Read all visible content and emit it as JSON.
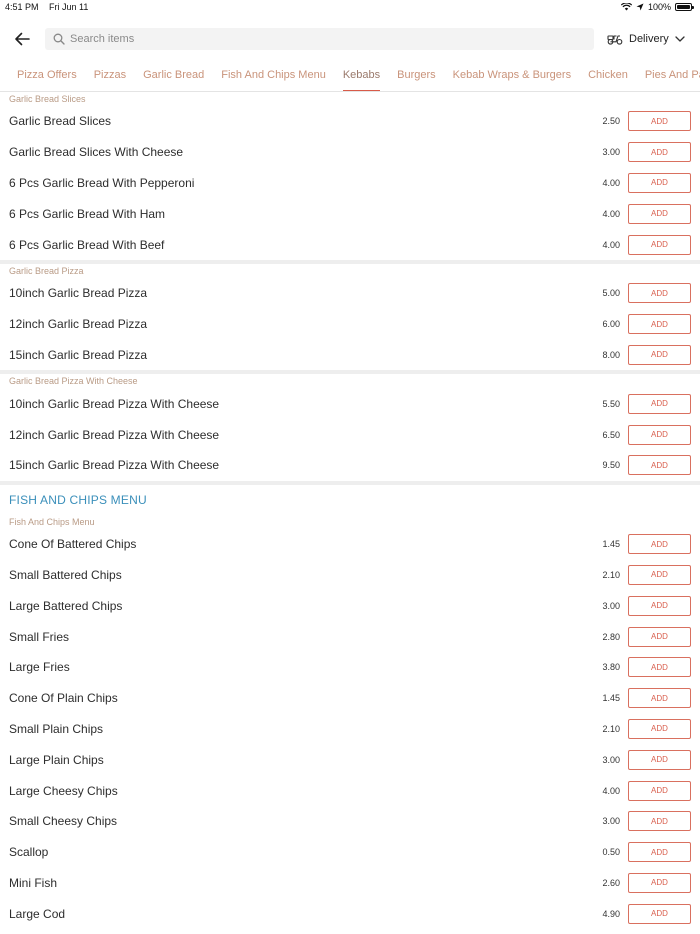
{
  "status": {
    "time": "4:51 PM",
    "date": "Fri Jun 11",
    "battery": "100%"
  },
  "search": {
    "placeholder": "Search items"
  },
  "delivery": {
    "label": "Delivery"
  },
  "tabs": [
    "Pizza Offers",
    "Pizzas",
    "Garlic Bread",
    "Fish And Chips Menu",
    "Kebabs",
    "Burgers",
    "Kebab Wraps & Burgers",
    "Chicken",
    "Pies And Pasties"
  ],
  "active_tab": "Kebabs",
  "add_label": "ADD",
  "sections": [
    {
      "heading": "Garlic Bread Slices",
      "items": [
        {
          "name": "Garlic Bread Slices",
          "price": "2.50"
        },
        {
          "name": "Garlic Bread Slices With Cheese",
          "price": "3.00"
        },
        {
          "name": "6 Pcs Garlic Bread With Pepperoni",
          "price": "4.00"
        },
        {
          "name": "6 Pcs Garlic Bread With Ham",
          "price": "4.00"
        },
        {
          "name": "6 Pcs Garlic Bread With Beef",
          "price": "4.00"
        }
      ]
    },
    {
      "heading": "Garlic Bread Pizza",
      "items": [
        {
          "name": "10inch Garlic Bread Pizza",
          "price": "5.00"
        },
        {
          "name": "12inch Garlic Bread Pizza",
          "price": "6.00"
        },
        {
          "name": "15inch Garlic Bread Pizza",
          "price": "8.00"
        }
      ]
    },
    {
      "heading": "Garlic Bread Pizza With Cheese",
      "items": [
        {
          "name": "10inch Garlic Bread Pizza With Cheese",
          "price": "5.50"
        },
        {
          "name": "12inch Garlic Bread Pizza With Cheese",
          "price": "6.50"
        },
        {
          "name": "15inch Garlic Bread Pizza With Cheese",
          "price": "9.50"
        }
      ]
    },
    {
      "category": "FISH AND CHIPS MENU",
      "heading": "Fish And Chips Menu",
      "items": [
        {
          "name": "Cone Of Battered Chips",
          "price": "1.45"
        },
        {
          "name": "Small Battered Chips",
          "price": "2.10"
        },
        {
          "name": "Large Battered Chips",
          "price": "3.00"
        },
        {
          "name": "Small Fries",
          "price": "2.80"
        },
        {
          "name": "Large Fries",
          "price": "3.80"
        },
        {
          "name": "Cone Of Plain Chips",
          "price": "1.45"
        },
        {
          "name": "Small Plain Chips",
          "price": "2.10"
        },
        {
          "name": "Large Plain Chips",
          "price": "3.00"
        },
        {
          "name": "Large Cheesy Chips",
          "price": "4.00"
        },
        {
          "name": "Small Cheesy Chips",
          "price": "3.00"
        },
        {
          "name": "Scallop",
          "price": "0.50"
        },
        {
          "name": "Mini Fish",
          "price": "2.60"
        },
        {
          "name": "Large Cod",
          "price": "4.90"
        }
      ]
    }
  ],
  "colors": {
    "accent": "#d9604f",
    "tab_text": "#c9937a",
    "category": "#3a8fba",
    "subheading": "#b99b86"
  },
  "icons": {
    "back": "arrow-left-icon",
    "search": "search-icon",
    "delivery": "scooter-icon",
    "chevron": "chevron-down-icon"
  }
}
